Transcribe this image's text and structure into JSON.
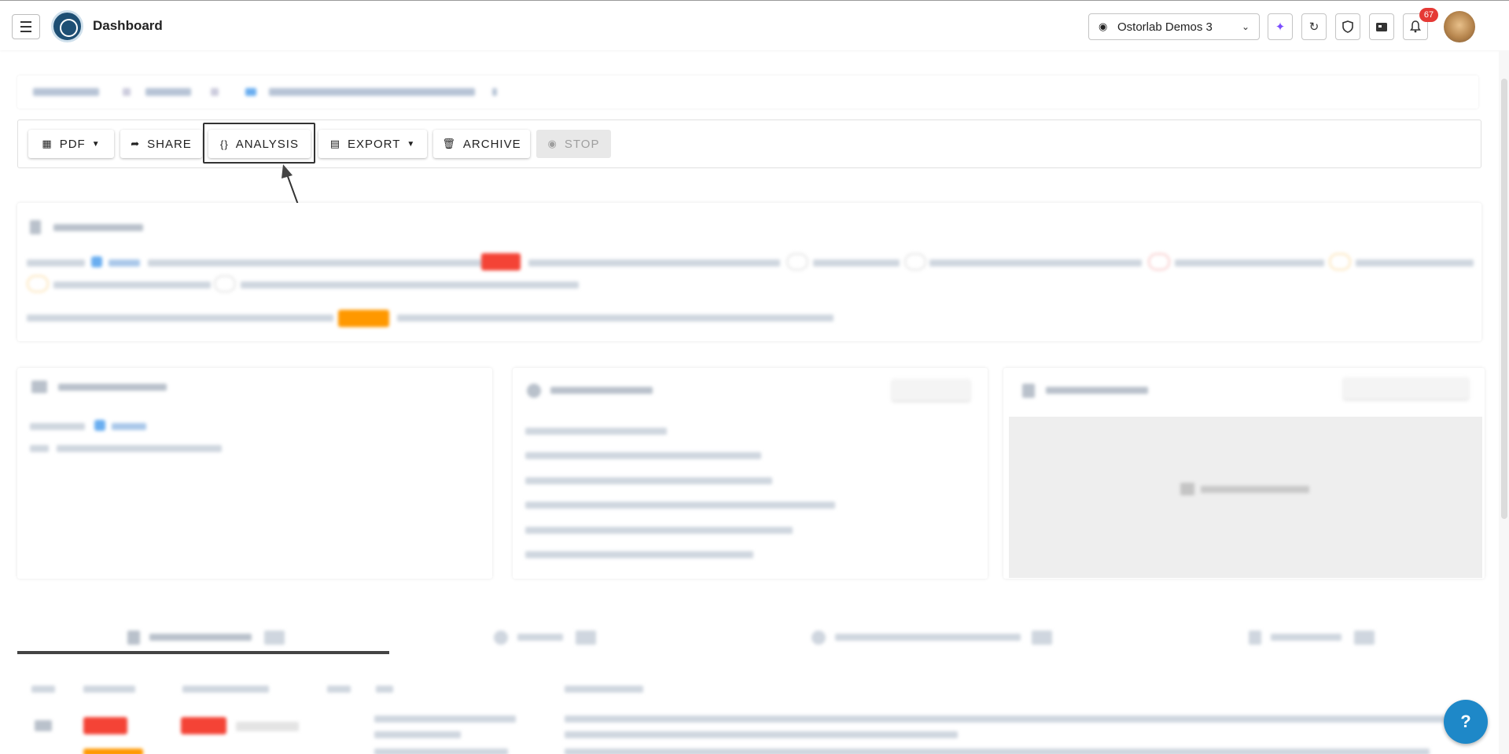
{
  "header": {
    "title": "Dashboard",
    "org_name": "Ostorlab Demos 3",
    "notifications_count": "67"
  },
  "toolbar": {
    "pdf_label": "PDF",
    "share_label": "SHARE",
    "analysis_label": "ANALYSIS",
    "export_label": "EXPORT",
    "archive_label": "ARCHIVE",
    "stop_label": "STOP"
  },
  "colors": {
    "critical_red": "#f44336",
    "warning_orange": "#ff9800",
    "accent_blue": "#1e88c8",
    "badge_red": "#e53935"
  },
  "icons": {
    "menu": "hamburger-icon",
    "org": "group-icon",
    "ai": "sparkle-icon",
    "sync": "sync-icon",
    "shield": "shield-icon",
    "card": "id-card-icon",
    "bell": "bell-icon",
    "help": "help-icon"
  },
  "help_label": "?"
}
